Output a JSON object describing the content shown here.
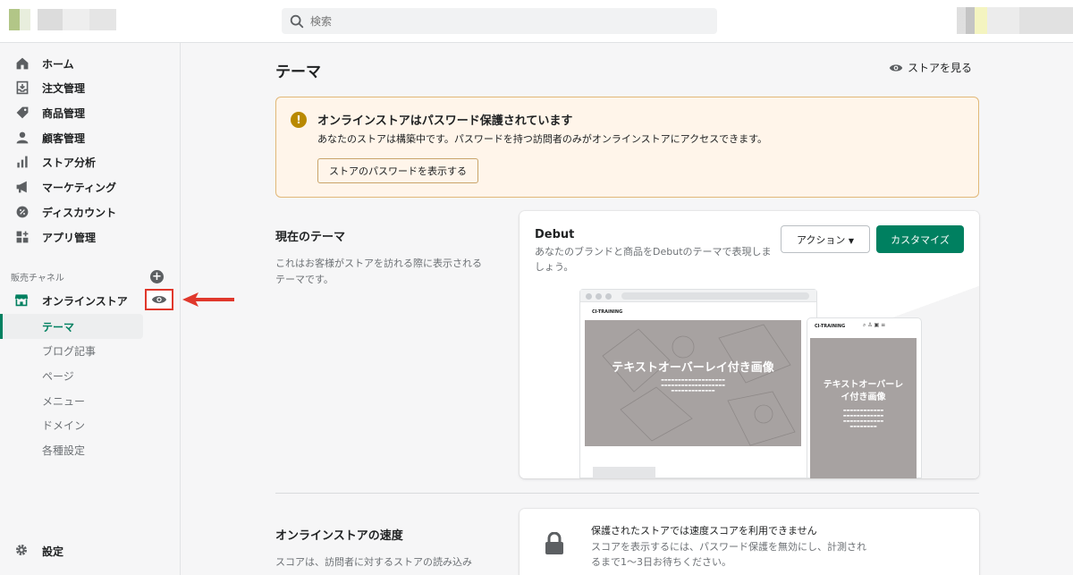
{
  "topbar": {
    "search_placeholder": "検索"
  },
  "sidebar": {
    "items": [
      {
        "label": "ホーム",
        "icon": "home-icon"
      },
      {
        "label": "注文管理",
        "icon": "orders-icon"
      },
      {
        "label": "商品管理",
        "icon": "tag-icon"
      },
      {
        "label": "顧客管理",
        "icon": "person-icon"
      },
      {
        "label": "ストア分析",
        "icon": "bar-chart-icon"
      },
      {
        "label": "マーケティング",
        "icon": "megaphone-icon"
      },
      {
        "label": "ディスカウント",
        "icon": "discount-icon"
      },
      {
        "label": "アプリ管理",
        "icon": "apps-icon"
      }
    ],
    "sales_channels_title": "販売チャネル",
    "online_store": "オンラインストア",
    "sub_items": [
      "テーマ",
      "ブログ記事",
      "ページ",
      "メニュー",
      "ドメイン",
      "各種設定"
    ],
    "settings": "設定"
  },
  "main": {
    "title": "テーマ",
    "view_store": "ストアを見る",
    "banner": {
      "title": "オンラインストアはパスワード保護されています",
      "text": "あなたのストアは構築中です。パスワードを持つ訪問者のみがオンラインストアにアクセスできます。",
      "button": "ストアのパスワードを表示する"
    },
    "current_theme": {
      "title": "現在のテーマ",
      "desc": "これはお客様がストアを訪れる際に表示されるテーマです。",
      "theme_name": "Debut",
      "theme_desc": "あなたのブランドと商品をDebutのテーマで表現しましょう。",
      "action_button": "アクション",
      "customize_button": "カスタマイズ",
      "preview": {
        "store_name": "CI-TRAINING",
        "hero_title": "テキストオーバーレイ付き画像",
        "mobile_hero_line1": "テキストオーバーレ",
        "mobile_hero_line2": "イ付き画像"
      }
    },
    "speed": {
      "title": "オンラインストアの速度",
      "desc": "スコアは、訪問者に対するストアの読み込み",
      "card_title": "保護されたストアでは速度スコアを利用できません",
      "card_text": "スコアを表示するには、パスワード保護を無効にし、計測されるまで1〜3日お待ちください。"
    }
  },
  "colors": {
    "accent": "#008060",
    "highlight": "#e0382c",
    "banner_bg": "#fff5ea"
  }
}
